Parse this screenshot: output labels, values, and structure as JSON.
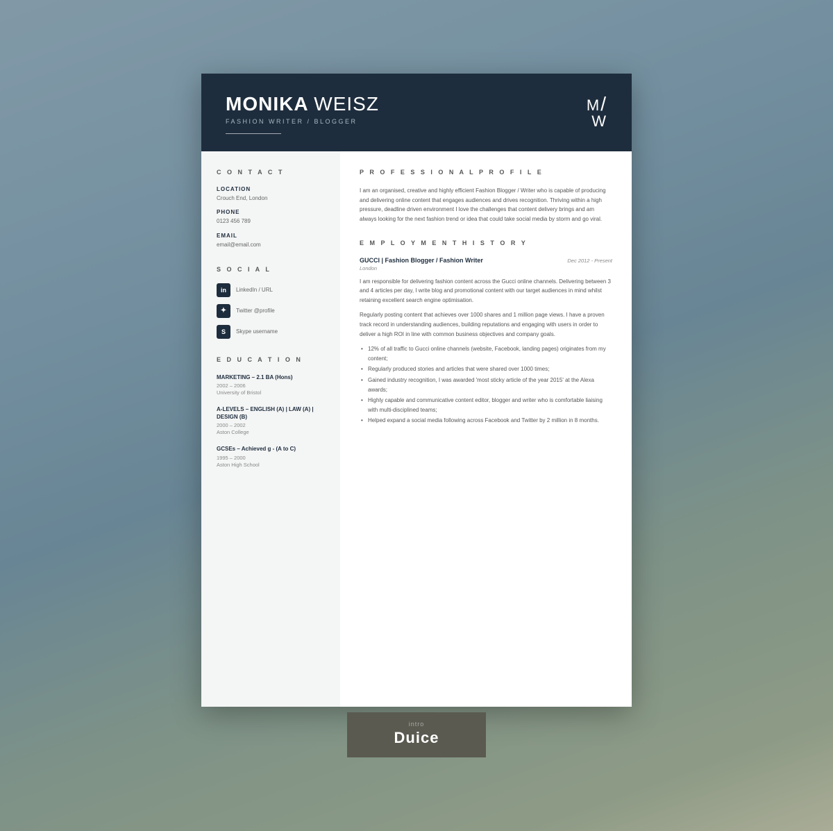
{
  "header": {
    "first_name": "MONIKA",
    "last_name": "WEISZ",
    "title": "FASHION WRITER / BLOGGER",
    "monogram_top": "M",
    "monogram_slash": "/",
    "monogram_bottom": "W"
  },
  "sidebar": {
    "contact_section_title": "C O N T A C T",
    "location_label": "LOCATION",
    "location_value": "Crouch End, London",
    "phone_label": "PHONE",
    "phone_value": "0123 456 789",
    "email_label": "EMAIL",
    "email_value": "email@email.com",
    "social_section_title": "S O C I A L",
    "social_items": [
      {
        "icon": "in",
        "text": "LinkedIn / URL"
      },
      {
        "icon": "🐦",
        "text": "Twitter @profile"
      },
      {
        "icon": "S",
        "text": "Skype username"
      }
    ],
    "education_section_title": "E D U C A T I O N",
    "education_items": [
      {
        "title": "MARKETING – 2.1 BA (Hons)",
        "years": "2002 – 2006",
        "school": "University of Bristol"
      },
      {
        "title": "A-LEVELS – ENGLISH (A) | LAW (A) | DESIGN (B)",
        "years": "2000 – 2002",
        "school": "Aston College"
      },
      {
        "title": "GCSEs – Achieved g - (A to C)",
        "years": "1995 – 2000",
        "school": "Aston High School"
      }
    ]
  },
  "main": {
    "profile_section_title": "P R O F E S S I O N A L   P R O F I L E",
    "profile_text": "I am an organised, creative and highly efficient Fashion Blogger / Writer who is capable of producing and delivering online content that engages audiences and drives recognition. Thriving within a high pressure, deadline driven environment I love the challenges that content delivery brings and am always looking for the next fashion trend or idea that could take social media by storm and go viral.",
    "employment_section_title": "E M P L O Y M E N T   H I S T O R Y",
    "jobs": [
      {
        "title": "GUCCI | Fashion Blogger / Fashion Writer",
        "date": "Dec 2012 - Present",
        "location": "London",
        "desc1": "I am responsible for delivering fashion content across the Gucci online channels. Delivering between 3 and 4 articles per day, I write blog and promotional content with our target audiences in mind whilst retaining excellent search engine optimisation.",
        "desc2": "Regularly posting content that achieves over 1000 shares and 1 million page views. I have a proven track record in understanding audiences, building reputations and engaging with users in order to deliver a high ROI in line with common business objectives and company goals.",
        "bullets": [
          "12% of all traffic to Gucci online channels (website, Facebook, landing pages) originates from my content;",
          "Regularly produced stories and articles that were shared over 1000 times;",
          "Gained industry recognition, I was awarded 'most sticky article of the year 2015' at the Alexa awards;",
          "Highly capable and communicative content editor, blogger and writer  who is comfortable liaising with multi-disciplined teams;",
          "Helped expand a social media following across Facebook and Twitter by 2 million in 8 months."
        ]
      }
    ]
  },
  "branding": {
    "intro": "intro",
    "name": "Duice"
  }
}
